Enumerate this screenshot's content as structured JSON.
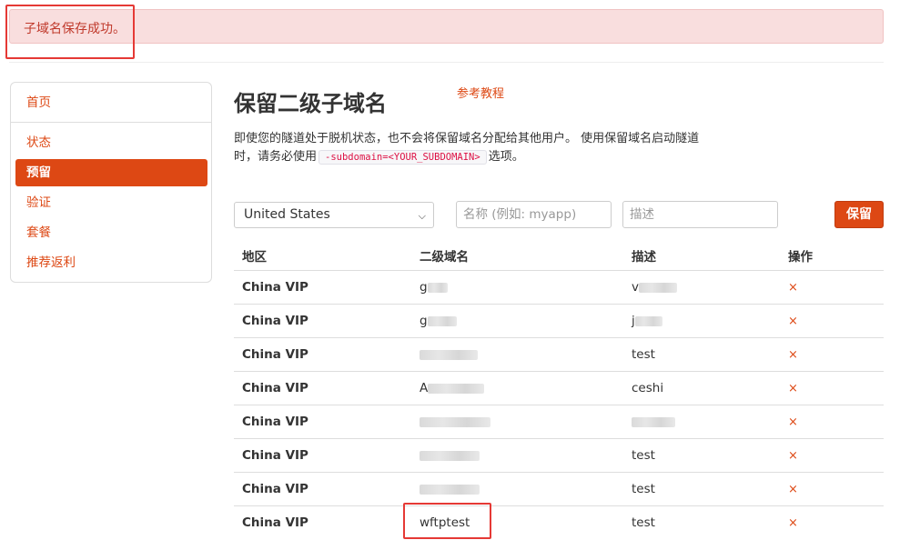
{
  "alert": {
    "message": "子域名保存成功。"
  },
  "sidebar": {
    "items": [
      {
        "label": "首页"
      },
      {
        "label": "状态"
      },
      {
        "label": "预留"
      },
      {
        "label": "验证"
      },
      {
        "label": "套餐"
      },
      {
        "label": "推荐返利"
      }
    ],
    "active_index": 2
  },
  "page": {
    "title": "保留二级子域名",
    "ref_link": "参考教程",
    "description_line1": "即使您的隧道处于脱机状态，也不会将保留域名分配给其他用户。 使用保留域名启动隧道",
    "description_line2_pre": "时，请务必使用",
    "description_code": "-subdomain=<YOUR_SUBDOMAIN>",
    "description_line2_post": "选项。"
  },
  "form": {
    "region_selected": "United States",
    "name_placeholder": "名称 (例如: myapp)",
    "desc_placeholder": "描述",
    "save_label": "保留"
  },
  "table": {
    "headers": [
      "地区",
      "二级域名",
      "描述",
      "操作"
    ],
    "rows": [
      {
        "region": "China VIP",
        "subdomain": "g",
        "description": "v",
        "action": "×"
      },
      {
        "region": "China VIP",
        "subdomain": "g",
        "description": "j",
        "action": "×"
      },
      {
        "region": "China VIP",
        "subdomain": "",
        "description": "test",
        "action": "×"
      },
      {
        "region": "China VIP",
        "subdomain": "A",
        "description": "ceshi",
        "action": "×"
      },
      {
        "region": "China VIP",
        "subdomain": "",
        "description": "",
        "action": "×"
      },
      {
        "region": "China VIP",
        "subdomain": "",
        "description": "test",
        "action": "×"
      },
      {
        "region": "China VIP",
        "subdomain": "",
        "description": "test",
        "action": "×"
      },
      {
        "region": "China VIP",
        "subdomain": "wftptest",
        "description": "test",
        "action": "×"
      }
    ]
  },
  "colors": {
    "accent": "#dd4814",
    "alert_bg": "#f9dede",
    "highlight": "#e53935"
  }
}
